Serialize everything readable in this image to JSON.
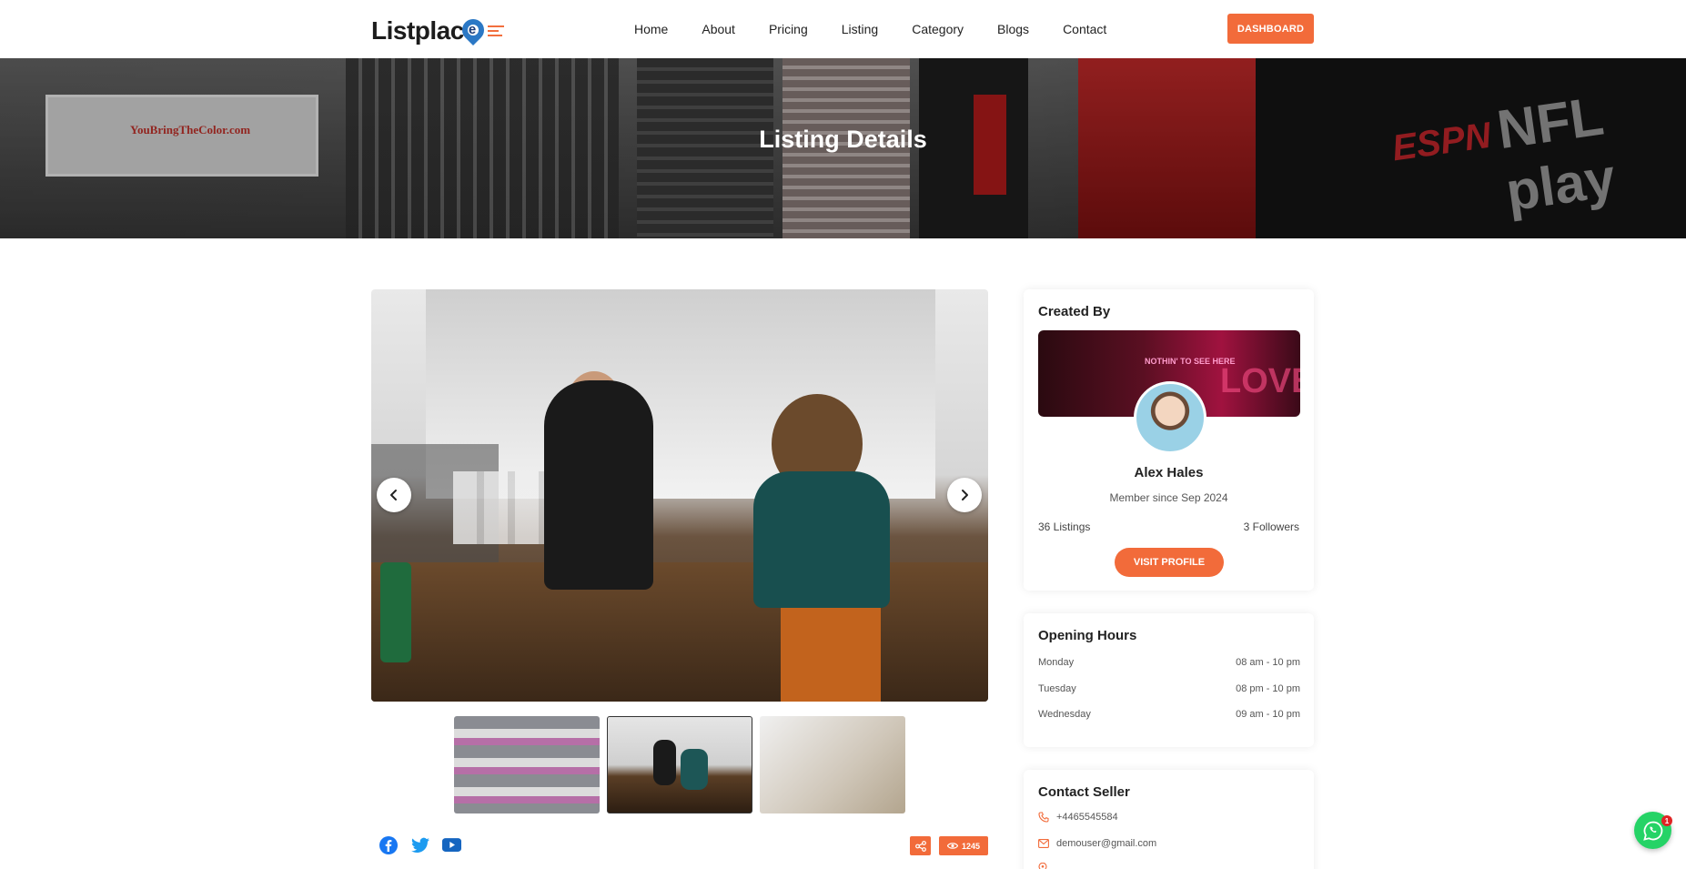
{
  "header": {
    "logo_text": "Listplac",
    "logo_pin_letter": "e",
    "nav": [
      "Home",
      "About",
      "Pricing",
      "Listing",
      "Category",
      "Blogs",
      "Contact"
    ],
    "dashboard_label": "DASHBOARD"
  },
  "hero": {
    "title": "Listing Details",
    "sign_text": "YouBringTheColor.com",
    "nfl_text": "NFL play",
    "espn_text": "ESPN"
  },
  "gallery": {
    "prev_icon": "chevron-left-icon",
    "next_icon": "chevron-right-icon",
    "thumbnail_count": 3
  },
  "actions": {
    "socials": [
      "facebook-icon",
      "twitter-icon",
      "youtube-icon"
    ],
    "views": "1245"
  },
  "created_by": {
    "title": "Created By",
    "cover_neon": "NOTHIN' TO SEE HERE",
    "cover_love": "LOVE",
    "name": "Alex Hales",
    "member_since": "Member since Sep 2024",
    "listings": "36 Listings",
    "followers": "3 Followers",
    "visit_label": "VISIT PROFILE"
  },
  "opening_hours": {
    "title": "Opening Hours",
    "rows": [
      {
        "day": "Monday",
        "time": "08 am - 10 pm"
      },
      {
        "day": "Tuesday",
        "time": "08 pm - 10 pm"
      },
      {
        "day": "Wednesday",
        "time": "09 am - 10 pm"
      }
    ]
  },
  "contact_seller": {
    "title": "Contact Seller",
    "phone": "+4465545584",
    "email": "demouser@gmail.com"
  },
  "whatsapp": {
    "badge": "1"
  },
  "colors": {
    "accent": "#f26b3a",
    "brand_blue": "#2b78c5",
    "whatsapp": "#25d366"
  }
}
